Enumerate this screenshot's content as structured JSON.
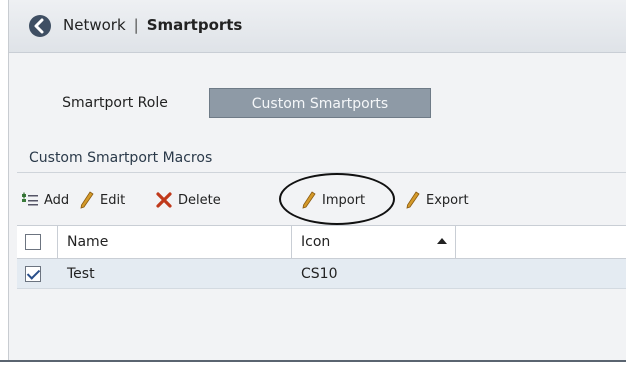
{
  "breadcrumb": {
    "parent": "Network",
    "separator": "|",
    "current": "Smartports"
  },
  "tabs": [
    {
      "label": "Smartport Role",
      "active": false
    },
    {
      "label": "Custom Smartports",
      "active": true
    }
  ],
  "section": {
    "title": "Custom Smartport Macros"
  },
  "toolbar": {
    "add_label": "Add",
    "edit_label": "Edit",
    "delete_label": "Delete",
    "import_label": "Import",
    "export_label": "Export"
  },
  "table": {
    "columns": [
      "Name",
      "Icon"
    ],
    "sort_column": "Icon",
    "sort_direction": "ascending",
    "rows": [
      {
        "checked": true,
        "name": "Test",
        "icon": "CS10"
      }
    ]
  },
  "icons": {
    "back": "back-arrow-icon",
    "add": "add-list-icon",
    "edit": "pencil-icon",
    "delete": "red-x-icon",
    "import": "pencil-icon",
    "export": "pencil-icon"
  },
  "colors": {
    "active_tab": "#8e9aa6",
    "selected_row": "#e4ebf2",
    "delete_x": "#c0391b",
    "pencil": "#d49a2a"
  }
}
